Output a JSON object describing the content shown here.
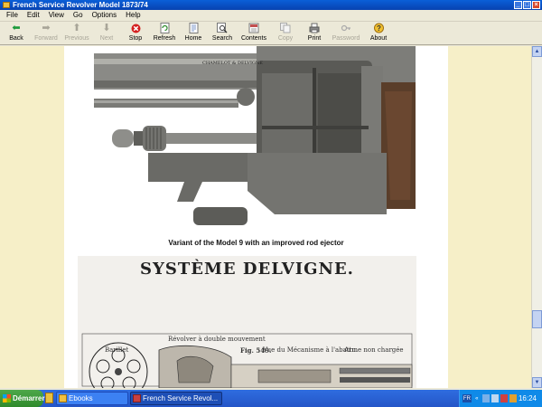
{
  "window": {
    "title": "French Service Revolver Model 1873/74"
  },
  "menu": {
    "items": [
      "File",
      "Edit",
      "View",
      "Go",
      "Options",
      "Help"
    ]
  },
  "toolbar": {
    "buttons": [
      {
        "label": "Back",
        "icon": "arrow-left-icon",
        "enabled": true
      },
      {
        "label": "Forward",
        "icon": "arrow-right-icon",
        "enabled": false
      },
      {
        "label": "Previous",
        "icon": "arrow-up-icon",
        "enabled": false
      },
      {
        "label": "Next",
        "icon": "arrow-down-icon",
        "enabled": false
      },
      {
        "label": "Stop",
        "icon": "stop-icon",
        "enabled": true
      },
      {
        "label": "Refresh",
        "icon": "refresh-icon",
        "enabled": true
      },
      {
        "label": "Home",
        "icon": "home-icon",
        "enabled": true
      },
      {
        "label": "Search",
        "icon": "search-icon",
        "enabled": true
      },
      {
        "label": "Contents",
        "icon": "contents-icon",
        "enabled": true
      },
      {
        "label": "Copy",
        "icon": "copy-icon",
        "enabled": false
      },
      {
        "label": "Print",
        "icon": "print-icon",
        "enabled": true
      },
      {
        "label": "Password",
        "icon": "password-icon",
        "enabled": false
      },
      {
        "label": "About",
        "icon": "about-icon",
        "enabled": true
      }
    ]
  },
  "page": {
    "photo_engraving": "CHAMELOT & DELVIGNE",
    "caption": "Variant of the Model 9 with an improved rod ejector",
    "diagram_title": "SYSTÈME DELVIGNE.",
    "diagram_labels": {
      "top": "Révolver à double mouvement",
      "fig": "Fig. 549.",
      "fig_text": "Vue du Mécanisme à l'abattu.",
      "fig_text2": "Arme non chargée",
      "left": "Barillet"
    }
  },
  "taskbar": {
    "start_label": "Démarrer",
    "items": [
      {
        "label": "Ebooks",
        "active": false
      },
      {
        "label": "French Service Revol...",
        "active": true
      }
    ],
    "tray_lang": "FR",
    "clock": "16:24"
  },
  "colors": {
    "titlebar": "#0842b0",
    "content_bg": "#f6efc8",
    "taskbar": "#2455c7",
    "start_green": "#2f8a2c"
  }
}
